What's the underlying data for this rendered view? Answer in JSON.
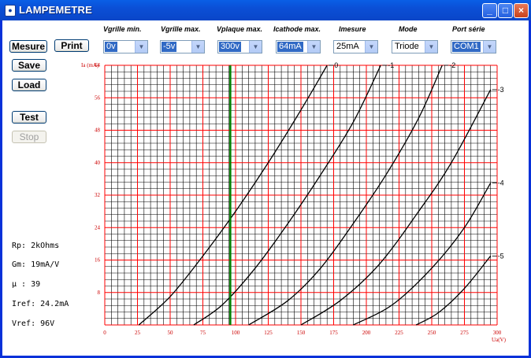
{
  "window": {
    "title": "LAMPEMETRE",
    "icon": "app-icon",
    "min_label": "_",
    "max_label": "□",
    "close_label": "×"
  },
  "buttons": {
    "mesure": "Mesure",
    "print": "Print",
    "save": "Save",
    "load": "Load",
    "test": "Test",
    "stop": "Stop"
  },
  "dropdowns": [
    {
      "label": "Vgrille min.",
      "value": "0v"
    },
    {
      "label": "Vgrille max.",
      "value": "-5v"
    },
    {
      "label": "Vplaque max.",
      "value": "300v"
    },
    {
      "label": "Icathode max.",
      "value": "64mA"
    },
    {
      "label": "Imesure",
      "value": "25mA"
    },
    {
      "label": "Mode",
      "value": "Triode"
    },
    {
      "label": "Port série",
      "value": "COM1"
    }
  ],
  "info": {
    "rp": "Rp: 2kOhms",
    "gm": "Gm: 19mA/V",
    "mu": "µ : 39",
    "iref": "Iref: 24.2mA",
    "vref": "Vref: 96V"
  },
  "colors": {
    "grid_minor": "#000000",
    "grid_major": "#ff0000",
    "curve": "#000000",
    "marker": "#008000",
    "axis_text": "#cc0000"
  },
  "chart_data": {
    "type": "line",
    "xlabel": "Ua(V)",
    "ylabel": "Ia (mA)",
    "xlim": [
      0,
      300
    ],
    "ylim": [
      0,
      64
    ],
    "x_ticks": [
      0,
      25,
      50,
      75,
      100,
      125,
      150,
      175,
      200,
      225,
      250,
      275,
      300
    ],
    "y_ticks": [
      8,
      16,
      24,
      32,
      40,
      48,
      56,
      64
    ],
    "grid": true,
    "marker_x": 96,
    "series": [
      {
        "name": "0",
        "x": [
          26,
          50,
          75,
          100,
          125,
          150,
          170
        ],
        "y": [
          0,
          7,
          17,
          28,
          40,
          53,
          64
        ]
      },
      {
        "name": "-1",
        "x": [
          68,
          90,
          115,
          140,
          165,
          190,
          211
        ],
        "y": [
          0,
          5,
          14,
          25,
          37,
          50,
          64
        ]
      },
      {
        "name": "-2",
        "x": [
          110,
          140,
          165,
          190,
          215,
          240,
          258
        ],
        "y": [
          0,
          6,
          14,
          25,
          37,
          51,
          64
        ]
      },
      {
        "name": "-3",
        "x": [
          150,
          180,
          210,
          240,
          265,
          295
        ],
        "y": [
          0,
          6,
          15,
          28,
          40,
          58
        ]
      },
      {
        "name": "-4",
        "x": [
          190,
          220,
          250,
          275,
          295
        ],
        "y": [
          0,
          5,
          14,
          24,
          35
        ]
      },
      {
        "name": "-5",
        "x": [
          238,
          255,
          275,
          295
        ],
        "y": [
          0,
          3,
          9,
          17
        ]
      }
    ]
  }
}
